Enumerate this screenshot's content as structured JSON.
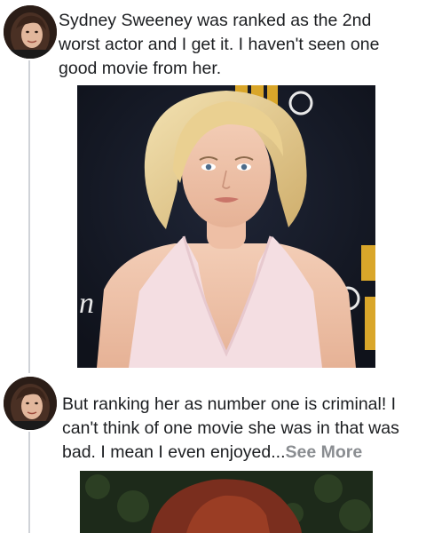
{
  "posts": [
    {
      "text": "Sydney Sweeney was ranked as the 2nd worst actor and I get it. I haven't seen one good movie from her."
    },
    {
      "text": "But ranking her as number one is criminal! I can't think of one movie she was in that was bad. I mean I even enjoyed...",
      "see_more_label": "See More"
    }
  ],
  "colors": {
    "text": "#1c1e21",
    "see_more": "#8a8d91",
    "thread_line": "#d0d3d8",
    "backdrop": "#151a26",
    "backdrop_logo": "#d9a62a"
  }
}
